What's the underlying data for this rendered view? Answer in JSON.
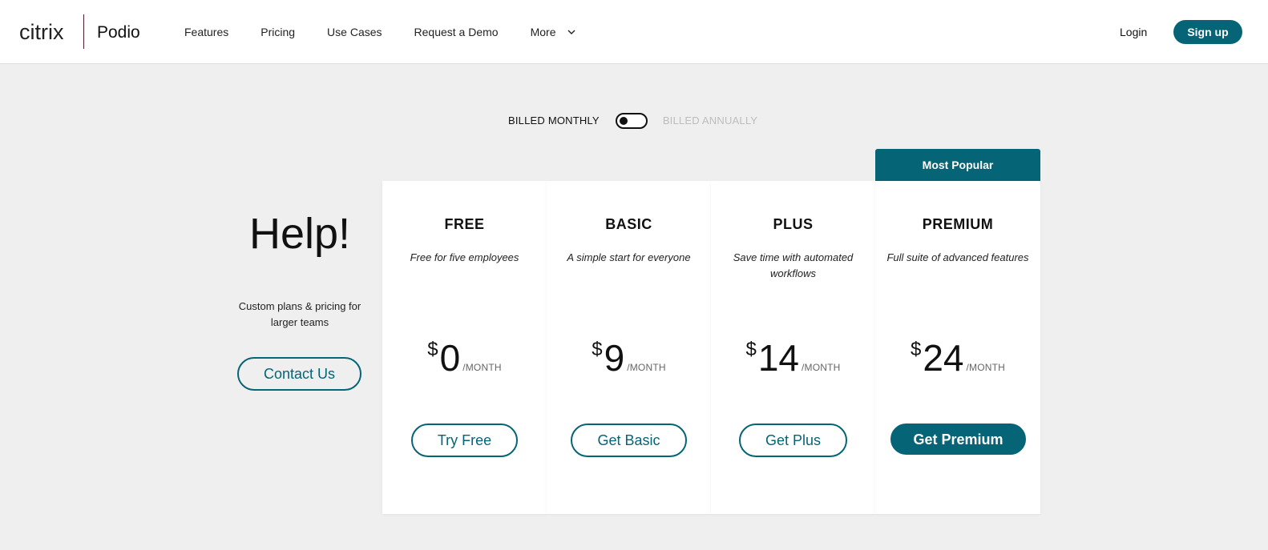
{
  "header": {
    "brand_citrix": "citrix",
    "brand_podio": "Podio",
    "nav": [
      "Features",
      "Pricing",
      "Use Cases",
      "Request a Demo"
    ],
    "nav_more": "More",
    "login": "Login",
    "signup": "Sign up"
  },
  "billing": {
    "monthly_label": "BILLED MONTHLY",
    "annually_label": "BILLED ANNUALLY",
    "selected": "monthly"
  },
  "help": {
    "title": "Help!",
    "description": "Custom plans & pricing for larger teams",
    "contact_label": "Contact Us"
  },
  "popular_banner": "Most Popular",
  "plans": [
    {
      "name": "FREE",
      "tagline": "Free for five employees",
      "currency": "$",
      "price": "0",
      "period": "/MONTH",
      "cta": "Try Free"
    },
    {
      "name": "BASIC",
      "tagline": "A simple start for everyone",
      "currency": "$",
      "price": "9",
      "period": "/MONTH",
      "cta": "Get Basic"
    },
    {
      "name": "PLUS",
      "tagline": "Save time with automated workflows",
      "currency": "$",
      "price": "14",
      "period": "/MONTH",
      "cta": "Get Plus"
    },
    {
      "name": "PREMIUM",
      "tagline": "Full suite of advanced features",
      "currency": "$",
      "price": "24",
      "period": "/MONTH",
      "cta": "Get Premium"
    }
  ],
  "colors": {
    "brand_teal": "#056475",
    "background": "#efefef",
    "card": "#ffffff"
  }
}
